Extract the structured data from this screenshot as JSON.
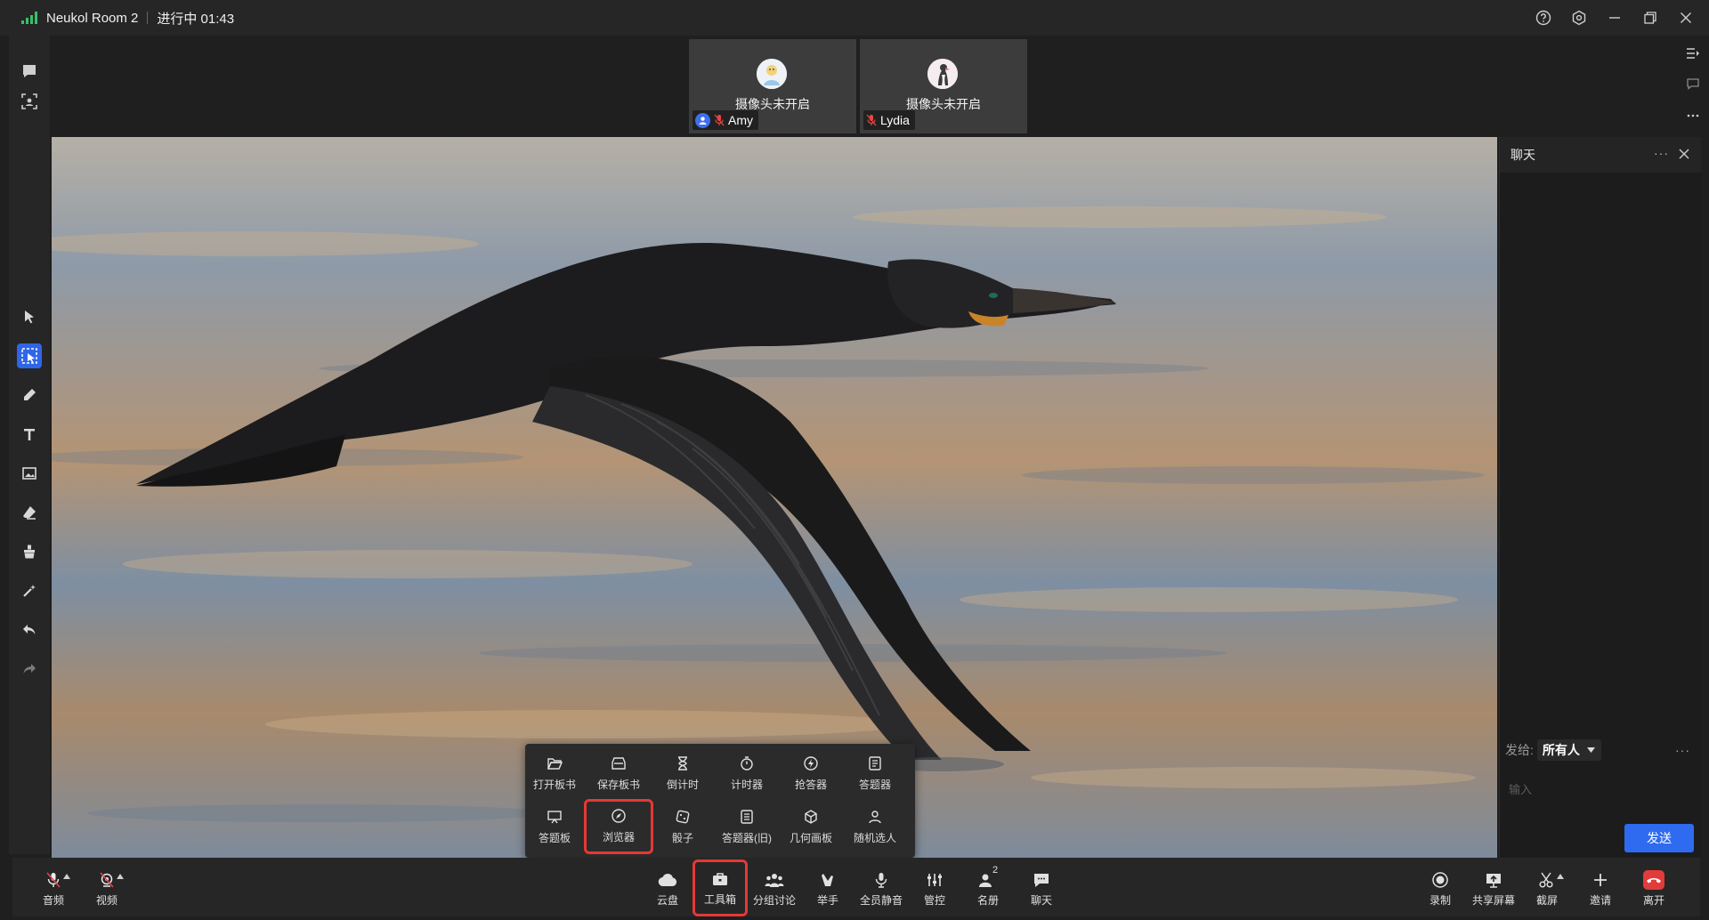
{
  "titlebar": {
    "room_name": "Neukol Room 2",
    "status": "进行中 01:43",
    "signal_color": "#36c26a",
    "controls": [
      "help-icon",
      "settings-icon",
      "minimize-icon",
      "restore-icon",
      "close-icon"
    ]
  },
  "left_toolbar": {
    "items": [
      "chat-bubble-icon",
      "screenshot-icon",
      "pointer-icon",
      "select-icon",
      "pen-icon",
      "text-icon",
      "image-icon",
      "eraser-icon",
      "clear-icon",
      "laser-icon",
      "undo-icon",
      "redo-icon"
    ],
    "active": "select-icon",
    "active_color": "#2f66e9"
  },
  "participants": [
    {
      "camera_status": "摄像头未开启",
      "name": "Amy",
      "host": true,
      "muted": true
    },
    {
      "camera_status": "摄像头未开启",
      "name": "Lydia",
      "host": false,
      "muted": true
    }
  ],
  "toolbox": {
    "row1": [
      {
        "label": "打开板书",
        "icon": "folder-open-icon"
      },
      {
        "label": "保存板书",
        "icon": "save-icon"
      },
      {
        "label": "倒计时",
        "icon": "hourglass-icon"
      },
      {
        "label": "计时器",
        "icon": "stopwatch-icon"
      },
      {
        "label": "抢答器",
        "icon": "buzzer-icon"
      },
      {
        "label": "答题器",
        "icon": "quiz-icon"
      }
    ],
    "row2": [
      {
        "label": "答题板",
        "icon": "answer-board-icon"
      },
      {
        "label": "浏览器",
        "icon": "compass-icon",
        "highlighted": true
      },
      {
        "label": "骰子",
        "icon": "dice-icon"
      },
      {
        "label": "答题器(旧)",
        "icon": "quiz-old-icon"
      },
      {
        "label": "几何画板",
        "icon": "cube-icon"
      },
      {
        "label": "随机选人",
        "icon": "random-person-icon"
      }
    ]
  },
  "chat": {
    "title": "聊天",
    "more": "···",
    "send_to_label": "发给:",
    "send_to_value": "所有人",
    "input_placeholder": "输入",
    "send_button": "发送",
    "send_button_color": "#2f6bf0"
  },
  "bottom_bar": {
    "left": [
      {
        "label": "音频",
        "icon": "mic-muted-icon"
      },
      {
        "label": "视频",
        "icon": "camera-off-icon"
      }
    ],
    "center": [
      {
        "label": "云盘",
        "icon": "cloud-icon"
      },
      {
        "label": "工具箱",
        "icon": "toolbox-icon",
        "highlighted": true
      },
      {
        "label": "分组讨论",
        "icon": "group-icon"
      },
      {
        "label": "举手",
        "icon": "raise-hand-icon"
      },
      {
        "label": "全员静音",
        "icon": "mute-all-icon"
      },
      {
        "label": "管控",
        "icon": "controls-icon"
      },
      {
        "label": "名册",
        "icon": "roster-icon",
        "badge": "2"
      },
      {
        "label": "聊天",
        "icon": "chat-icon"
      }
    ],
    "right": [
      {
        "label": "录制",
        "icon": "record-icon"
      },
      {
        "label": "共享屏幕",
        "icon": "share-screen-icon"
      },
      {
        "label": "截屏",
        "icon": "scissors-icon"
      },
      {
        "label": "邀请",
        "icon": "plus-icon"
      },
      {
        "label": "离开",
        "icon": "hangup-icon"
      }
    ],
    "highlight_color": "#e53935",
    "leave_color": "#e23b3b"
  }
}
